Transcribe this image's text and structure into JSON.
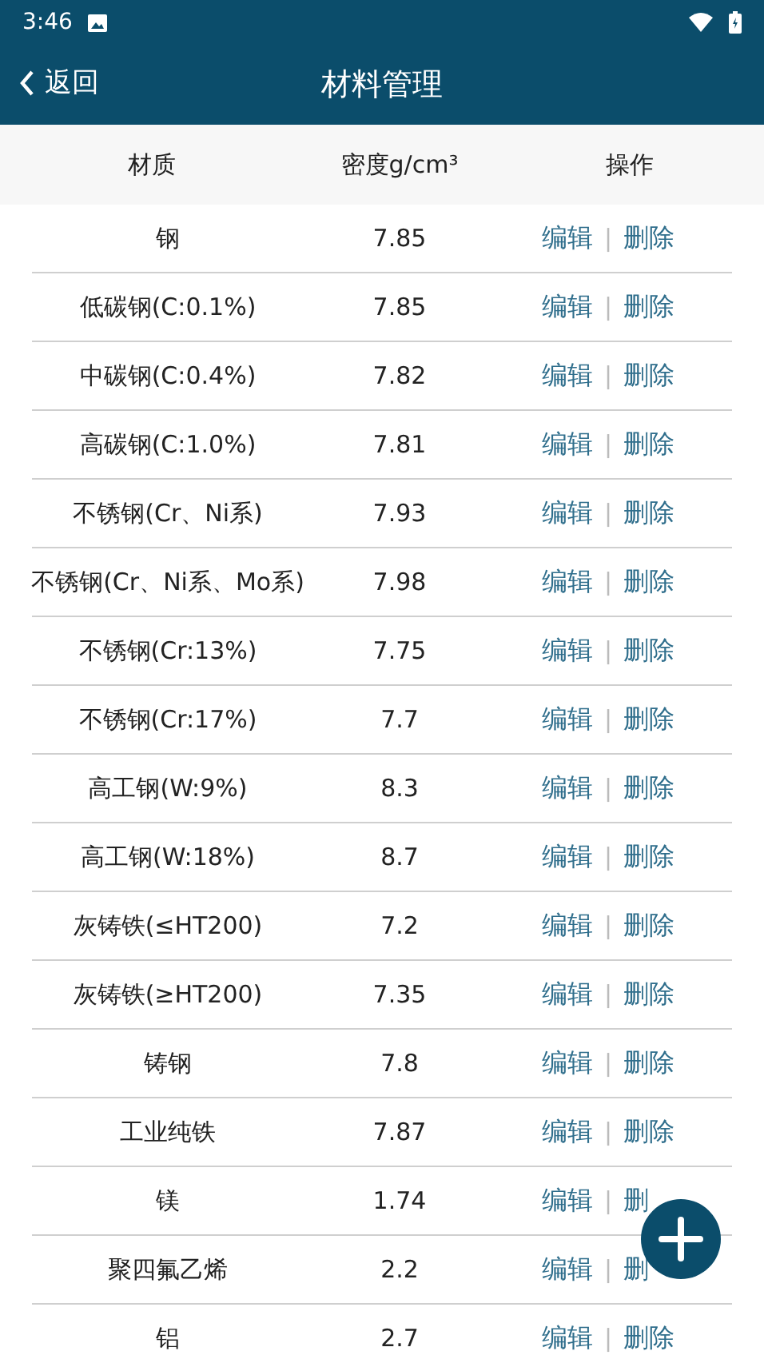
{
  "status_bar": {
    "time": "3:46"
  },
  "header": {
    "back": "返回",
    "title": "材料管理"
  },
  "table": {
    "columns": [
      "材质",
      "密度g/cm³",
      "操作"
    ],
    "rows": [
      {
        "material": "钢",
        "density": "7.85",
        "edit": "编辑",
        "separator": "|",
        "delete": "删除"
      },
      {
        "material": "低碳钢(C:0.1%)",
        "density": "7.85",
        "edit": "编辑",
        "separator": "|",
        "delete": "删除"
      },
      {
        "material": "中碳钢(C:0.4%)",
        "density": "7.82",
        "edit": "编辑",
        "separator": "|",
        "delete": "删除"
      },
      {
        "material": "高碳钢(C:1.0%)",
        "density": "7.81",
        "edit": "编辑",
        "separator": "|",
        "delete": "删除"
      },
      {
        "material": "不锈钢(Cr、Ni系)",
        "density": "7.93",
        "edit": "编辑",
        "separator": "|",
        "delete": "删除"
      },
      {
        "material": "不锈钢(Cr、Ni系、Mo系)",
        "density": "7.98",
        "edit": "编辑",
        "separator": "|",
        "delete": "删除"
      },
      {
        "material": "不锈钢(Cr:13%)",
        "density": "7.75",
        "edit": "编辑",
        "separator": "|",
        "delete": "删除"
      },
      {
        "material": "不锈钢(Cr:17%)",
        "density": "7.7",
        "edit": "编辑",
        "separator": "|",
        "delete": "删除"
      },
      {
        "material": "高工钢(W:9%)",
        "density": "8.3",
        "edit": "编辑",
        "separator": "|",
        "delete": "删除"
      },
      {
        "material": "高工钢(W:18%)",
        "density": "8.7",
        "edit": "编辑",
        "separator": "|",
        "delete": "删除"
      },
      {
        "material": "灰铸铁(≤HT200)",
        "density": "7.2",
        "edit": "编辑",
        "separator": "|",
        "delete": "删除"
      },
      {
        "material": "灰铸铁(≥HT200)",
        "density": "7.35",
        "edit": "编辑",
        "separator": "|",
        "delete": "删除"
      },
      {
        "material": "铸钢",
        "density": "7.8",
        "edit": "编辑",
        "separator": "|",
        "delete": "删除"
      },
      {
        "material": "工业纯铁",
        "density": "7.87",
        "edit": "编辑",
        "separator": "|",
        "delete": "删除"
      },
      {
        "material": "镁",
        "density": "1.74",
        "edit": "编辑",
        "separator": "|",
        "delete": "删"
      },
      {
        "material": "聚四氟乙烯",
        "density": "2.2",
        "edit": "编辑",
        "separator": "|",
        "delete": "删"
      },
      {
        "material": "铝",
        "density": "2.7",
        "edit": "编辑",
        "separator": "|",
        "delete": "删除"
      }
    ]
  }
}
